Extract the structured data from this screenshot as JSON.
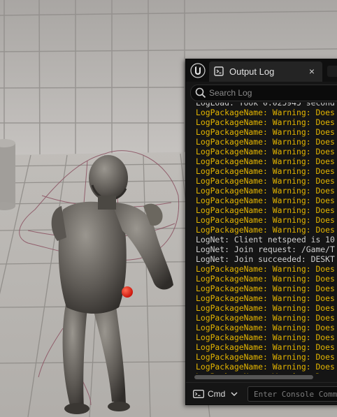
{
  "output_log": {
    "tab_title": "Output Log",
    "close_glyph": "×",
    "search_placeholder": "Search Log",
    "lines": [
      {
        "text": "LogLoad: Took 0.025945 second",
        "level": "info"
      },
      {
        "text": "LogPackageName: Warning: Does",
        "level": "warning"
      },
      {
        "text": "LogPackageName: Warning: Does",
        "level": "warning"
      },
      {
        "text": "LogPackageName: Warning: Does",
        "level": "warning"
      },
      {
        "text": "LogPackageName: Warning: Does",
        "level": "warning"
      },
      {
        "text": "LogPackageName: Warning: Does",
        "level": "warning"
      },
      {
        "text": "LogPackageName: Warning: Does",
        "level": "warning"
      },
      {
        "text": "LogPackageName: Warning: Does",
        "level": "warning"
      },
      {
        "text": "LogPackageName: Warning: Does",
        "level": "warning"
      },
      {
        "text": "LogPackageName: Warning: Does",
        "level": "warning"
      },
      {
        "text": "LogPackageName: Warning: Does",
        "level": "warning"
      },
      {
        "text": "LogPackageName: Warning: Does",
        "level": "warning"
      },
      {
        "text": "LogPackageName: Warning: Does",
        "level": "warning"
      },
      {
        "text": "LogPackageName: Warning: Does",
        "level": "warning"
      },
      {
        "text": "LogNet: Client netspeed is 10",
        "level": "info"
      },
      {
        "text": "LogNet: Join request: /Game/T",
        "level": "info"
      },
      {
        "text": "LogNet: Join succeeded: DESKT",
        "level": "info"
      },
      {
        "text": "LogPackageName: Warning: Does",
        "level": "warning"
      },
      {
        "text": "LogPackageName: Warning: Does",
        "level": "warning"
      },
      {
        "text": "LogPackageName: Warning: Does",
        "level": "warning"
      },
      {
        "text": "LogPackageName: Warning: Does",
        "level": "warning"
      },
      {
        "text": "LogPackageName: Warning: Does",
        "level": "warning"
      },
      {
        "text": "LogPackageName: Warning: Does",
        "level": "warning"
      },
      {
        "text": "LogPackageName: Warning: Does",
        "level": "warning"
      },
      {
        "text": "LogPackageName: Warning: Does",
        "level": "warning"
      },
      {
        "text": "LogPackageName: Warning: Does",
        "level": "warning"
      },
      {
        "text": "LogPackageName: Warning: Does",
        "level": "warning"
      },
      {
        "text": "LogPackageName: Warning: Does",
        "level": "warning"
      },
      {
        "text": "LogPackageName: Warning: Does",
        "level": "warning"
      }
    ],
    "cmd_label": "Cmd",
    "console_placeholder": "Enter Console Command",
    "colors": {
      "warning": "#e4b500",
      "info": "#cfcfcf",
      "background": "#151515"
    },
    "icons": {
      "engine_logo": "unreal-logo-icon",
      "tab": "output-log-icon",
      "search": "search-icon",
      "cmd": "console-icon",
      "dropdown": "chevron-down-icon"
    }
  },
  "viewport": {
    "colors": {
      "wall": "#b8b5b2",
      "floor": "#b7b4b0",
      "grid": "#7f7c79",
      "mannequin": "#6e6a64",
      "collision": "#8a5060",
      "marker": "#e21a10"
    },
    "icons": {
      "character": "mannequin-character",
      "collision": "collision-sphere",
      "marker": "red-sphere-marker"
    }
  }
}
